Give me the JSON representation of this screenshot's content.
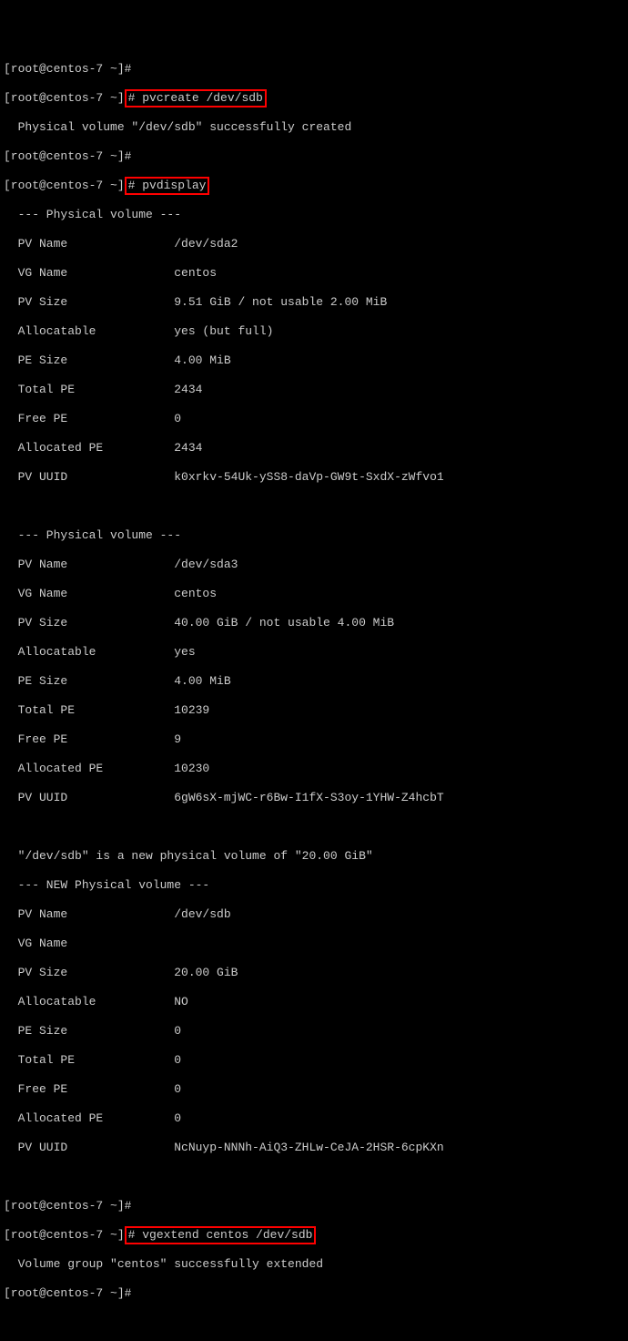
{
  "prompts": {
    "p1": "[root@centos-7 ~]#",
    "p2_pre": "[root@centos-7 ~]",
    "cmd_pvcreate": "# pvcreate /dev/sdb",
    "cmd_pvdisplay": "# pvdisplay",
    "cmd_vgextend": "# vgextend centos /dev/sdb"
  },
  "msgs": {
    "pv_created": "  Physical volume \"/dev/sdb\" successfully created",
    "vg_extended": "  Volume group \"centos\" successfully extended"
  },
  "pv1": {
    "header": "  --- Physical volume ---",
    "name": "  PV Name               /dev/sda2",
    "vg": "  VG Name               centos",
    "size": "  PV Size               9.51 GiB / not usable 2.00 MiB",
    "alloc": "  Allocatable           yes (but full)",
    "pesize": "  PE Size               4.00 MiB",
    "totalpe": "  Total PE              2434",
    "freepe": "  Free PE               0",
    "allocpe": "  Allocated PE          2434",
    "uuid": "  PV UUID               k0xrkv-54Uk-ySS8-daVp-GW9t-SxdX-zWfvo1"
  },
  "pv2": {
    "header": "  --- Physical volume ---",
    "name": "  PV Name               /dev/sda3",
    "vg": "  VG Name               centos",
    "size": "  PV Size               40.00 GiB / not usable 4.00 MiB",
    "alloc": "  Allocatable           yes",
    "pesize": "  PE Size               4.00 MiB",
    "totalpe": "  Total PE              10239",
    "freepe": "  Free PE               9",
    "allocpe": "  Allocated PE          10230",
    "uuid": "  PV UUID               6gW6sX-mjWC-r6Bw-I1fX-S3oy-1YHW-Z4hcbT"
  },
  "pv3": {
    "newmsg": "  \"/dev/sdb\" is a new physical volume of \"20.00 GiB\"",
    "header": "  --- NEW Physical volume ---",
    "name": "  PV Name               /dev/sdb",
    "vg": "  VG Name               ",
    "size": "  PV Size               20.00 GiB",
    "alloc": "  Allocatable           NO",
    "pesize": "  PE Size               0   ",
    "totalpe": "  Total PE              0",
    "freepe": "  Free PE               0",
    "allocpe": "  Allocated PE          0",
    "uuid": "  PV UUID               NcNuyp-NNNh-AiQ3-ZHLw-CeJA-2HSR-6cpKXn"
  },
  "blank": "   "
}
